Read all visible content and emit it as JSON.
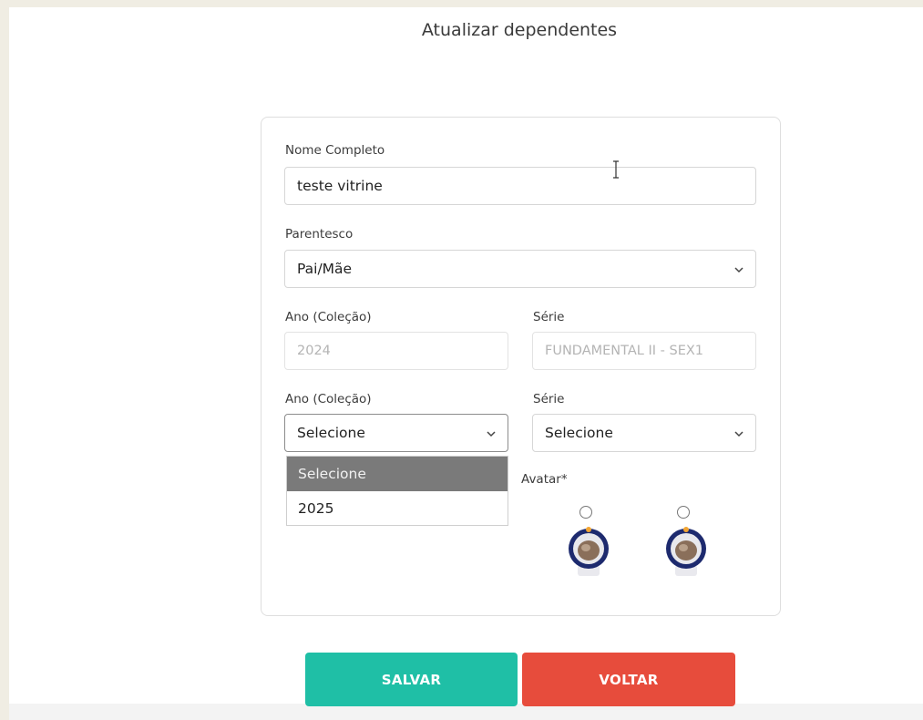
{
  "page": {
    "title": "Atualizar dependentes"
  },
  "form": {
    "nome": {
      "label": "Nome Completo",
      "value": "teste vitrine"
    },
    "parentesco": {
      "label": "Parentesco",
      "value": "Pai/Mãe"
    },
    "ano_atual": {
      "label": "Ano (Coleção)",
      "value": "2024"
    },
    "serie_atual": {
      "label": "Série",
      "value": "FUNDAMENTAL II - SEX1"
    },
    "ano_novo": {
      "label": "Ano (Coleção)",
      "value": "Selecione"
    },
    "serie_nova": {
      "label": "Série",
      "value": "Selecione"
    },
    "ano_options": [
      "Selecione",
      "2025"
    ],
    "avatar": {
      "label": "Avatar*"
    }
  },
  "buttons": {
    "save": "SALVAR",
    "back": "VOLTAR"
  },
  "colors": {
    "save": "#1fbfa6",
    "back": "#e74c3c",
    "selected_option": "#7a7a7a"
  },
  "icons": [
    "chevron-down-icon",
    "text-cursor-icon",
    "astronaut-avatar-icon"
  ]
}
